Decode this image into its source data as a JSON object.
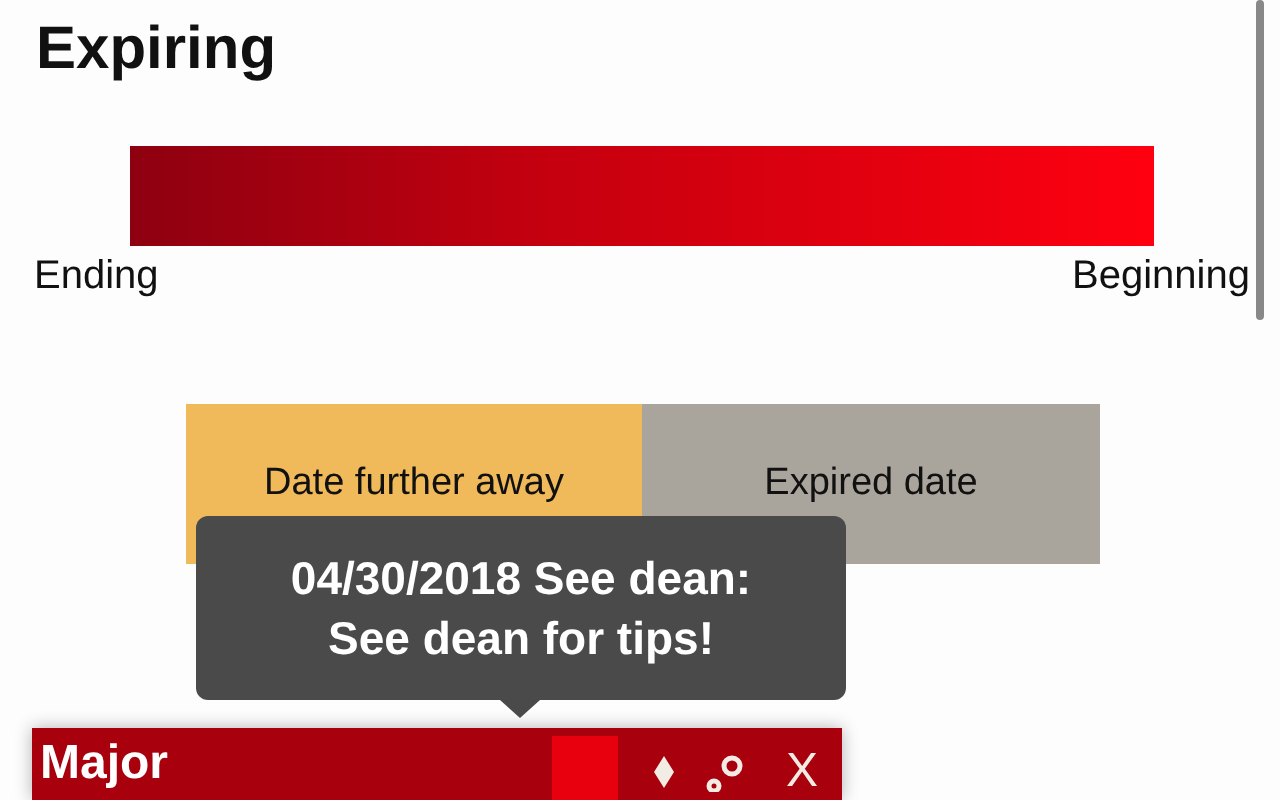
{
  "title": "Expiring",
  "gradient": {
    "start_label": "Ending",
    "end_label": "Beginning"
  },
  "legend": [
    {
      "label": "Date further away",
      "kind": "future"
    },
    {
      "label": "Expired date",
      "kind": "expired"
    }
  ],
  "tooltip": {
    "lines": [
      "04/30/2018 See dean:",
      "See dean for tips!"
    ]
  },
  "card": {
    "title": "Major",
    "color": "#e8000f",
    "close": "X"
  }
}
